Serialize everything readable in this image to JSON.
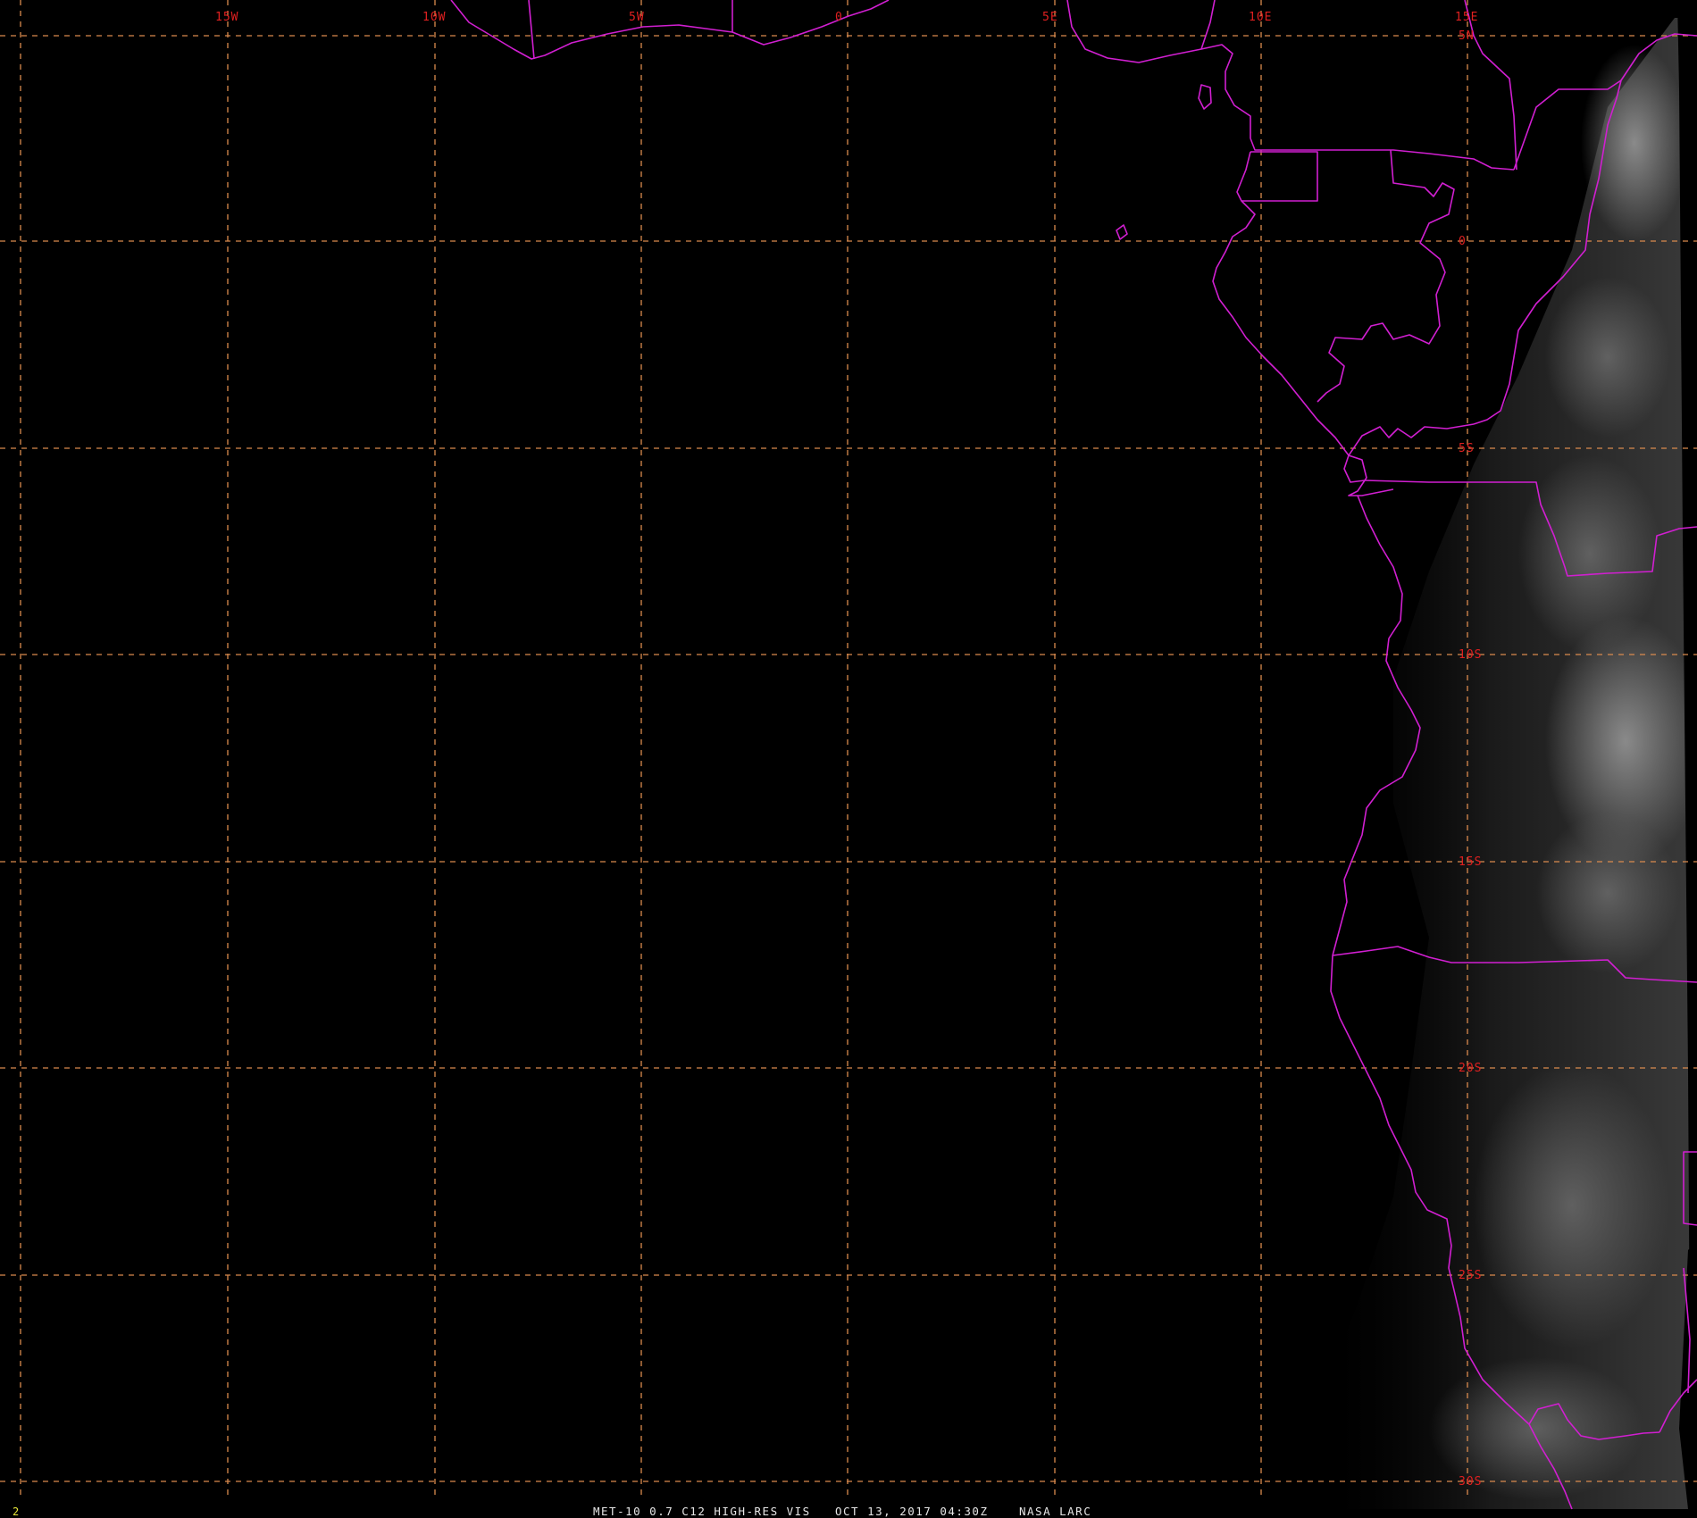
{
  "frame_number": "2",
  "caption": {
    "instrument": "MET-10 0.7 C12 HIGH-RES VIS",
    "datetime": "OCT 13, 2017 04:30Z",
    "source": "NASA LARC"
  },
  "longitude_labels": [
    "15W",
    "10W",
    "5W",
    "0",
    "5E",
    "10E",
    "15E"
  ],
  "latitude_labels": [
    "5N",
    "0",
    "5S",
    "10S",
    "15S",
    "20S",
    "25S",
    "30S"
  ],
  "colors": {
    "background": "#000000",
    "graticule": "#d98a4e",
    "tick_labels": "#e02020",
    "borders": "#d11fd1",
    "footer_text": "#e6e6e6",
    "frame_number": "#e6e63a"
  }
}
